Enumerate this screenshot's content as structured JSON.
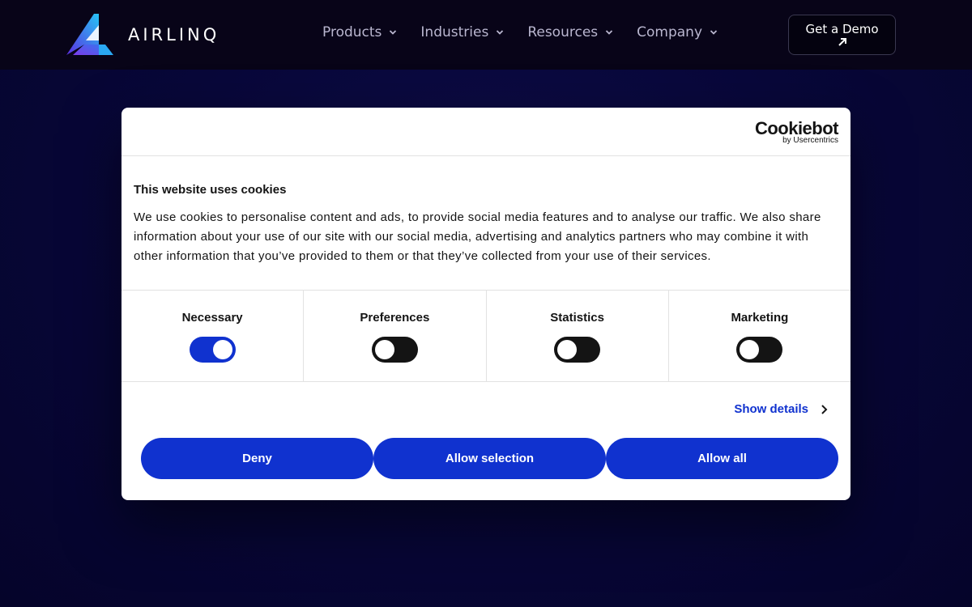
{
  "header": {
    "brand": "AIRLINQ",
    "nav": [
      {
        "label": "Products",
        "icon": "chevron-down-icon"
      },
      {
        "label": "Industries",
        "icon": "chevron-down-icon"
      },
      {
        "label": "Resources",
        "icon": "chevron-down-icon"
      },
      {
        "label": "Company",
        "icon": "chevron-down-icon"
      }
    ],
    "cta": {
      "label": "Get a Demo",
      "icon": "arrow-up-right-icon"
    }
  },
  "cookie_dialog": {
    "provider": "Cookiebot",
    "provider_sub": "by Usercentrics",
    "title": "This website uses cookies",
    "text": "We use cookies to personalise content and ads, to provide social media features and to analyse our traffic. We also share information about your use of our site with our social media, advertising and analytics partners who may combine it with other information that you’ve provided to them or that they’ve collected from your use of their services.",
    "categories": [
      {
        "label": "Necessary",
        "enabled": true
      },
      {
        "label": "Preferences",
        "enabled": false
      },
      {
        "label": "Statistics",
        "enabled": false
      },
      {
        "label": "Marketing",
        "enabled": false
      }
    ],
    "show_details": "Show details",
    "buttons": {
      "deny": "Deny",
      "allow_selection": "Allow selection",
      "allow_all": "Allow all"
    }
  },
  "colors": {
    "accent": "#1032cf",
    "header_bg": "#080418",
    "page_bg": "#06052a"
  }
}
